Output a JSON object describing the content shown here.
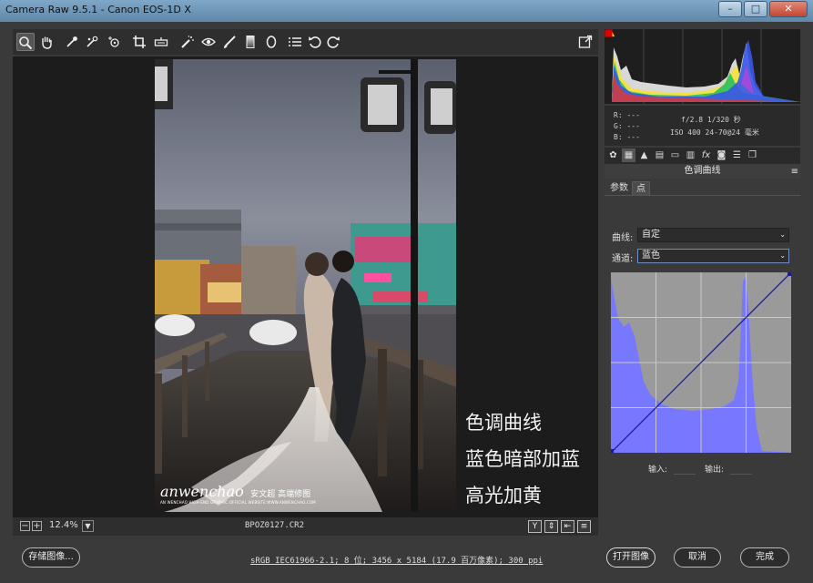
{
  "window": {
    "title": "Camera Raw 9.5.1 -  Canon EOS-1D X",
    "minimize_glyph": "–",
    "maximize_glyph": "□",
    "close_glyph": "✕"
  },
  "toolbar": {
    "tools": [
      {
        "name": "zoom-tool",
        "icon": "magnifier-icon",
        "active": true
      },
      {
        "name": "hand-tool",
        "icon": "hand-icon"
      },
      {
        "name": "white-balance-tool",
        "icon": "eyedropper-icon"
      },
      {
        "name": "color-sampler-tool",
        "icon": "color-sampler-icon"
      },
      {
        "name": "targeted-adjustment-tool",
        "icon": "target-adjust-icon"
      },
      {
        "name": "crop-tool",
        "icon": "crop-icon"
      },
      {
        "name": "straighten-tool",
        "icon": "level-icon"
      },
      {
        "name": "spot-removal-tool",
        "icon": "spot-removal-icon"
      },
      {
        "name": "red-eye-tool",
        "icon": "eye-icon"
      },
      {
        "name": "adjustment-brush-tool",
        "icon": "brush-icon"
      },
      {
        "name": "graduated-filter-tool",
        "icon": "graduated-filter-icon"
      },
      {
        "name": "radial-filter-tool",
        "icon": "ellipse-icon"
      },
      {
        "name": "preferences-tool",
        "icon": "list-icon"
      },
      {
        "name": "rotate-left-tool",
        "icon": "rotate-ccw-icon"
      },
      {
        "name": "rotate-right-tool",
        "icon": "rotate-cw-icon"
      }
    ],
    "fullscreen_icon": "export-icon"
  },
  "overlay_text": [
    "色调曲线",
    "蓝色暗部加蓝",
    "高光加黄"
  ],
  "watermark": {
    "brand": "anwenchao",
    "cn": "安文超 高端修图",
    "sub": "AN WENCHAO HIGH-END GRAPHIC OFFICIAL WEBSITE:WWW.ANWENCHAO.COM"
  },
  "status": {
    "zoom_minus": "−",
    "zoom_plus": "+",
    "zoom": "12.4%",
    "filename": "BPOZ0127.CR2",
    "right_buttons": [
      "Y",
      "⇕",
      "⇤",
      "≡"
    ]
  },
  "readout": {
    "r": "R:  ---",
    "g": "G:  ---",
    "b": "B:  ---",
    "exif_line1": "f/2.8  1/320 秒",
    "exif_line2": "ISO 400  24-70@24 毫米"
  },
  "panel": {
    "tab_icons": [
      "aperture-icon",
      "grid-icon",
      "mountain-icon",
      "hsl-icon",
      "split-tone-icon",
      "lens-icon",
      "fx-icon",
      "camera-icon",
      "presets-icon",
      "snapshots-icon"
    ],
    "title": "色调曲线",
    "menu_glyph": "≡",
    "subtabs": [
      "参数",
      "点"
    ],
    "curve_label": "曲线:",
    "curve_value": "自定",
    "channel_label": "通道:",
    "channel_value": "蓝色",
    "input_label": "输入:",
    "output_label": "输出:"
  },
  "colors": {
    "accent_blue": "#6a8fc0",
    "histogram_blue": "#7878ff",
    "clip_shadow": "#f0d800",
    "clip_highlight": "#e00000"
  },
  "footer": {
    "save_label": "存储图像...",
    "workflow_link": "sRGB IEC61966-2.1; 8 位; 3456 x 5184 (17.9 百万像素); 300 ppi",
    "open_label": "打开图像",
    "cancel_label": "取消",
    "done_label": "完成"
  }
}
